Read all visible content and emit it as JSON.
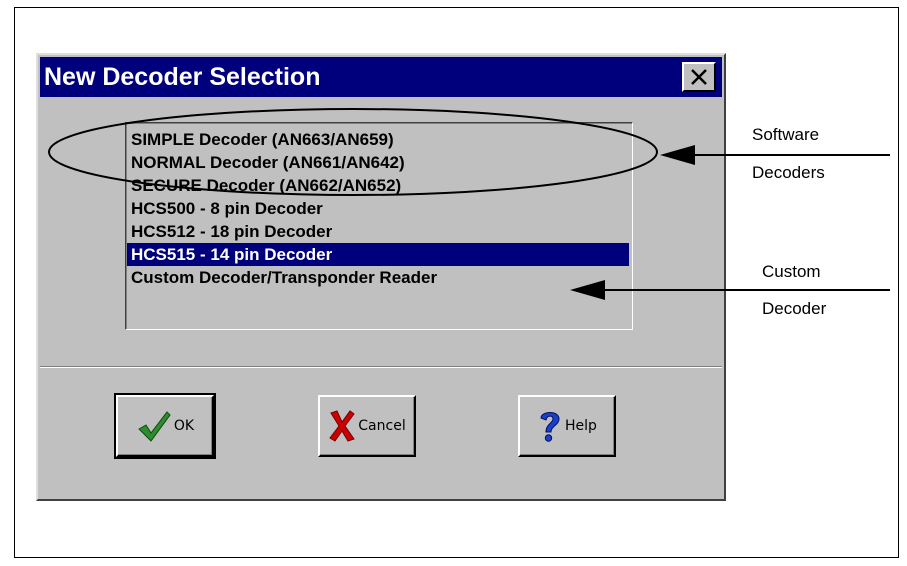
{
  "dialog": {
    "title": "New Decoder Selection",
    "close_label": "×",
    "items": [
      {
        "label": "SIMPLE Decoder (AN663/AN659)",
        "selected": false
      },
      {
        "label": "NORMAL Decoder (AN661/AN642)",
        "selected": false
      },
      {
        "label": "SECURE Decoder (AN662/AN652)",
        "selected": false
      },
      {
        "label": "HCS500 -  8 pin Decoder",
        "selected": false
      },
      {
        "label": "HCS512 - 18 pin Decoder",
        "selected": false
      },
      {
        "label": "HCS515 - 14 pin Decoder",
        "selected": true
      },
      {
        "label": "Custom Decoder/Transponder Reader",
        "selected": false
      }
    ],
    "buttons": {
      "ok_label": "OK",
      "cancel_label": "Cancel",
      "help_label": "Help"
    }
  },
  "annotations": {
    "software_line1": "Software",
    "software_line2": "Decoders",
    "custom_line1": "Custom",
    "custom_line2": "Decoder"
  },
  "colors": {
    "title_bar": "#00007c",
    "dialog_face": "#c0c0c0",
    "selection": "#00007c",
    "ok_check": "#2e8b2e",
    "cancel_x": "#cc0000",
    "help_question": "#1a40c8"
  }
}
